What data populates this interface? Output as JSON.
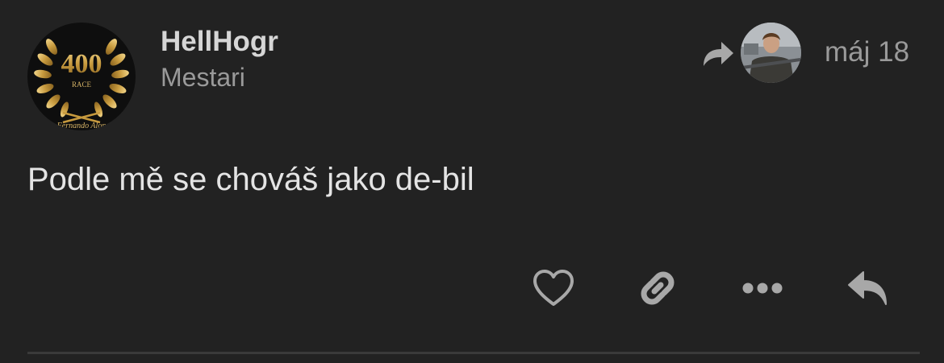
{
  "post": {
    "author": {
      "username": "HellHogr",
      "title": "Mestari",
      "avatar_badge": {
        "number": "400",
        "subtitle": "RACE",
        "caption": "Fernando Alon"
      }
    },
    "reply_indicator": {
      "icon": "reply-arrow-icon"
    },
    "date": "máj 18",
    "body": "Podle mě se chováš jako de-bil",
    "actions": [
      {
        "name": "like",
        "icon": "heart-icon"
      },
      {
        "name": "copy-link",
        "icon": "link-icon"
      },
      {
        "name": "more",
        "icon": "ellipsis-icon"
      },
      {
        "name": "reply",
        "icon": "reply-icon"
      }
    ]
  },
  "colors": {
    "background": "#222222",
    "text_primary": "#e4e4e4",
    "text_secondary": "#9a9a9a",
    "icon": "#a8a8a8",
    "gold": "#c9a24a"
  }
}
